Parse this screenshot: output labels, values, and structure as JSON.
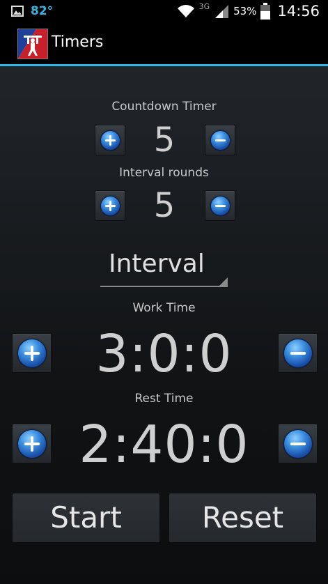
{
  "status_bar": {
    "temperature": "82°",
    "network_type": "3G",
    "battery_percent": "53%",
    "clock": "14:56"
  },
  "action_bar": {
    "title": "Timers"
  },
  "countdown": {
    "label": "Countdown Timer",
    "value": "5"
  },
  "rounds": {
    "label": "Interval rounds",
    "value": "5"
  },
  "mode_select": {
    "selected": "Interval"
  },
  "work": {
    "label": "Work Time",
    "value": "3:0:0"
  },
  "rest": {
    "label": "Rest Time",
    "value": "2:40:0"
  },
  "buttons": {
    "start": "Start",
    "reset": "Reset"
  },
  "colors": {
    "accent": "#33b5e5",
    "background": "#15171a"
  }
}
